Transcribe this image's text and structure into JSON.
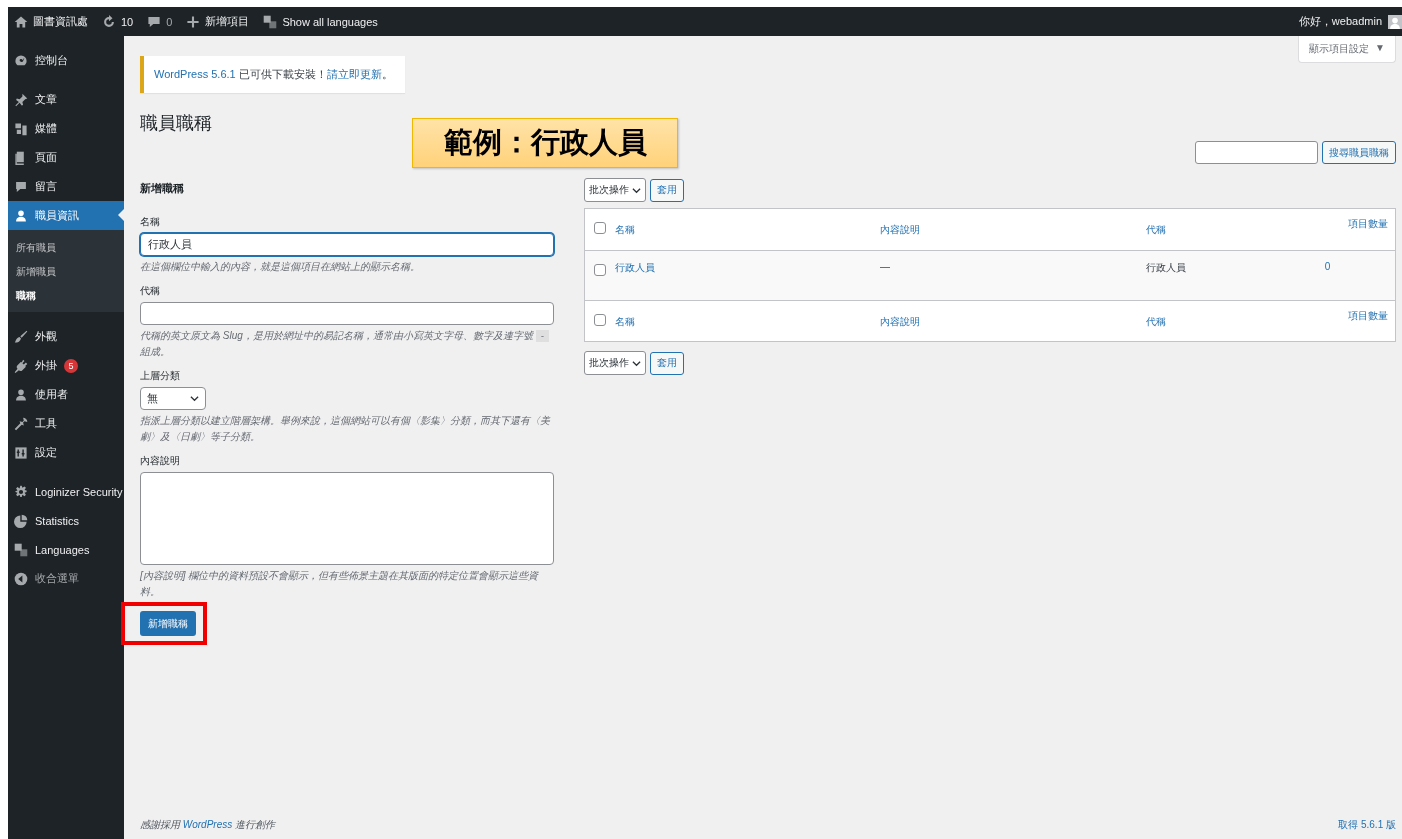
{
  "admin_bar": {
    "items": [
      {
        "kind": "home",
        "label": "圖書資訊處"
      },
      {
        "kind": "updates",
        "label": "10"
      },
      {
        "kind": "comments",
        "label": "0"
      },
      {
        "kind": "new",
        "label": "新增項目"
      },
      {
        "kind": "languages",
        "label": "Show all languages"
      }
    ],
    "greeting": "你好，webadmin"
  },
  "sidebar": {
    "groups": [
      {
        "items": [
          {
            "kind": "dashboard",
            "label": "控制台",
            "selected": false
          }
        ]
      },
      {
        "items": [
          {
            "kind": "pin",
            "label": "文章",
            "selected": false
          },
          {
            "kind": "media",
            "label": "媒體",
            "selected": false
          },
          {
            "kind": "page",
            "label": "頁面",
            "selected": false
          },
          {
            "kind": "comment",
            "label": "留言",
            "selected": false
          },
          {
            "kind": "user",
            "label": "職員資訊",
            "selected": true,
            "children": [
              {
                "label": "所有職員",
                "selected": false
              },
              {
                "label": "新增職員",
                "selected": false
              },
              {
                "label": "職稱",
                "selected": true
              }
            ]
          }
        ]
      },
      {
        "items": [
          {
            "kind": "brush",
            "label": "外觀",
            "selected": false
          },
          {
            "kind": "plugin",
            "label": "外掛",
            "selected": false,
            "badge": "5"
          },
          {
            "kind": "user",
            "label": "使用者",
            "selected": false
          },
          {
            "kind": "wrench",
            "label": "工具",
            "selected": false
          },
          {
            "kind": "settings",
            "label": "設定",
            "selected": false
          }
        ]
      },
      {
        "items": [
          {
            "kind": "gear",
            "label": "Loginizer Security",
            "selected": false
          },
          {
            "kind": "pie",
            "label": "Statistics",
            "selected": false
          },
          {
            "kind": "translate",
            "label": "Languages",
            "selected": false
          },
          {
            "kind": "collapse",
            "label": "收合選單",
            "selected": false
          }
        ]
      }
    ]
  },
  "screen_options": {
    "label": "顯示項目設定",
    "caret": "▼"
  },
  "notice": {
    "link": "WordPress 5.6.1",
    "text": "已可供下載安裝！",
    "action_link": "請立即更新",
    "end": "。"
  },
  "page_title": "職員職稱",
  "callout": "範例：行政人員",
  "search": {
    "button": "搜尋職員職稱"
  },
  "add_form": {
    "heading": "新增職稱",
    "fields": [
      {
        "kind": "text",
        "label": "名稱",
        "value": "行政人員",
        "focused": true,
        "hint": "在這個欄位中輸入的內容，就是這個項目在網站上的顯示名稱。"
      },
      {
        "kind": "text",
        "label": "代稱",
        "focused": false,
        "hint": "代稱的英文原文為 Slug，是用於網址中的易記名稱，通常由小寫英文字母、數字及連字號",
        "hint_code": "-",
        "hint_end": "組成。"
      },
      {
        "kind": "select",
        "label": "上層分類",
        "value": "無",
        "hint": "指派上層分類以建立階層架構。舉例來說，這個網站可以有個〈影集〉分類，而其下還有〈美劇〉及〈日劇〉等子分類。"
      },
      {
        "kind": "textarea",
        "label": "內容說明",
        "hint": "[內容說明] 欄位中的資料預設不會顯示，但有些佈景主題在其版面的特定位置會顯示這些資料。"
      }
    ],
    "submit": "新增職稱",
    "submit_highlighted": true
  },
  "bulk_top": {
    "select": "批次操作",
    "apply": "套用"
  },
  "table": {
    "columns": [
      "名稱",
      "內容說明",
      "代稱",
      "項目數量"
    ],
    "header_checked": false,
    "rows": [
      {
        "cells": [
          "行政人員",
          "—",
          "行政人員",
          "0"
        ],
        "checked": false
      }
    ],
    "footer_columns": [
      "名稱",
      "內容說明",
      "代稱",
      "項目數量"
    ],
    "footer_checked": false
  },
  "bulk_bottom": {
    "select": "批次操作",
    "apply": "套用"
  },
  "footer": {
    "text": "感謝採用",
    "link": "WordPress",
    "text_end": "進行創作",
    "version": "取得 5.6.1 版"
  }
}
